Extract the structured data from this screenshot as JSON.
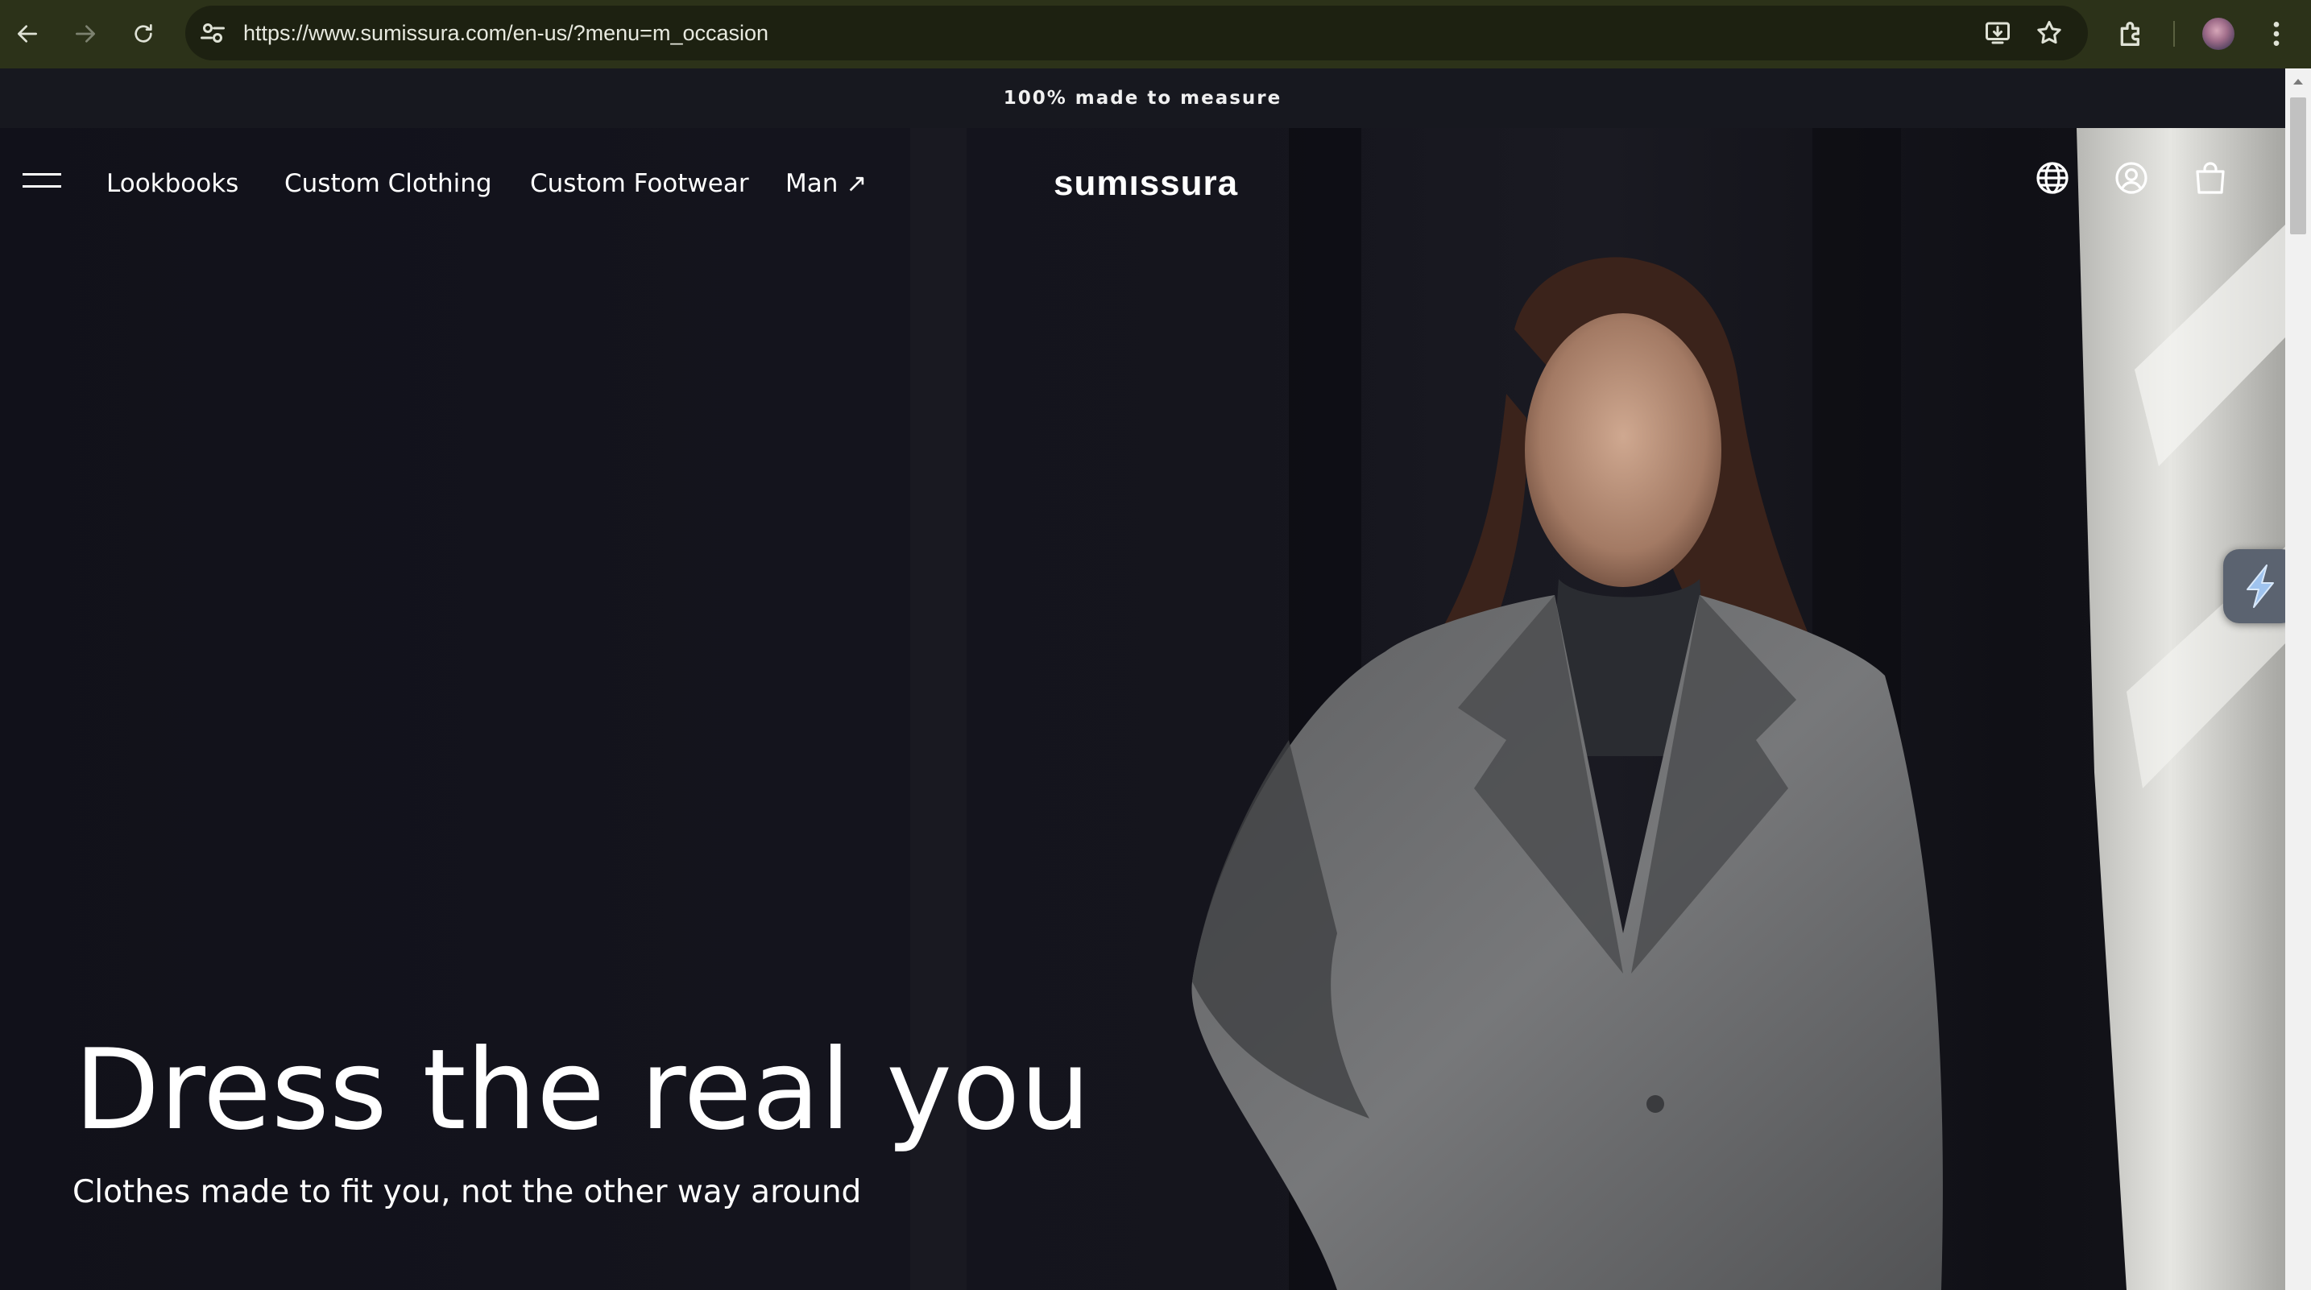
{
  "browser": {
    "url": "https://www.sumissura.com/en-us/?menu=m_occasion",
    "icons": [
      "back-arrow-icon",
      "forward-arrow-icon",
      "reload-icon",
      "site-settings-icon",
      "install-app-icon",
      "bookmark-star-icon",
      "extensions-icon",
      "profile-avatar",
      "more-menu-icon"
    ]
  },
  "announcement": {
    "text": "100% made to measure"
  },
  "nav": {
    "links": [
      "Lookbooks",
      "Custom Clothing",
      "Custom Footwear",
      "Man ↗"
    ],
    "logo": "sumıssura",
    "icons": [
      "menu-icon",
      "globe-icon",
      "account-icon",
      "shopping-bag-icon"
    ]
  },
  "hero": {
    "title": "Dress the real you",
    "subtitle": "Clothes made to fit you, not the other way around"
  },
  "colors": {
    "browser_bar": "#2c3219",
    "omnibox": "#1d2111",
    "page_background": "#14141b",
    "text": "#ffffff"
  }
}
